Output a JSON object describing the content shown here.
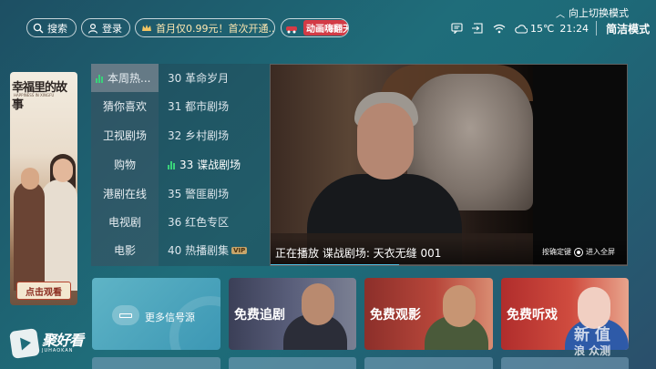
{
  "topbar": {
    "search_label": "搜索",
    "login_label": "登录",
    "promo_text": "首月仅0.99元！首次开通...",
    "anim_label": "动画嗨翻天",
    "switch_hint": "向上切换模式",
    "temperature": "15℃",
    "time": "21:24",
    "mode_label": "简洁模式",
    "icons": [
      "message-icon",
      "input-source-icon",
      "wifi-icon",
      "weather-icon"
    ]
  },
  "poster": {
    "title": "幸福里的故事",
    "subtitle": "HAPPINESS IN XINGFU",
    "cta": "点击观看"
  },
  "categories": {
    "items": [
      {
        "label": "本周热..."
      },
      {
        "label": "猜你喜欢"
      },
      {
        "label": "卫视剧场"
      },
      {
        "label": "购物"
      },
      {
        "label": "港剧在线"
      },
      {
        "label": "电视剧"
      },
      {
        "label": "电影"
      }
    ],
    "active_index": 0
  },
  "channels": {
    "items": [
      {
        "label": "30 革命岁月"
      },
      {
        "label": "31 都市剧场"
      },
      {
        "label": "32 乡村剧场"
      },
      {
        "label": "33 谍战剧场"
      },
      {
        "label": "35 警匪剧场"
      },
      {
        "label": "36 红色专区"
      },
      {
        "label": "40 热播剧集"
      }
    ],
    "active_index": 3,
    "vip_badge": "VIP"
  },
  "player": {
    "now_playing": "正在播放 谍战剧场: 天衣无缝 001",
    "hint_prefix": "按确定键",
    "hint_suffix": "进入全屏",
    "progress_fraction": 0.36
  },
  "cards": {
    "signal": "更多信号源",
    "drama": "免费追剧",
    "movie": "免费观影",
    "listen": "免费听戏"
  },
  "brand": {
    "name": "聚好看",
    "sub": "JUHAOKAN"
  },
  "watermark": {
    "line1": "新 值",
    "line2": "浪 众测"
  },
  "colors": {
    "accent_green": "#39d27a",
    "progress": "#4fc3e8",
    "vip_gold": "#c7a56b"
  }
}
